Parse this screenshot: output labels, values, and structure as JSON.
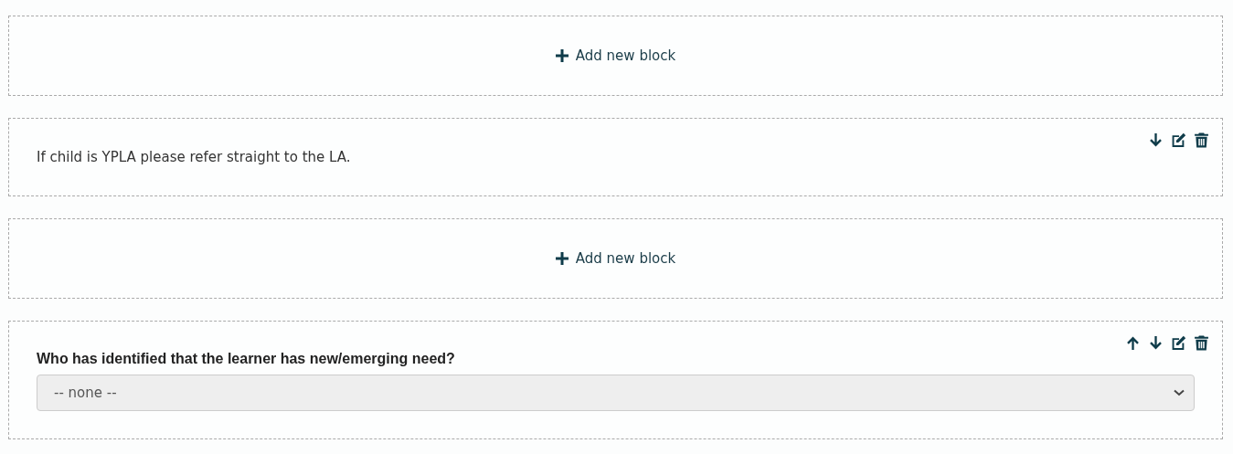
{
  "blocks": [
    {
      "kind": "add",
      "label": "Add new block"
    },
    {
      "kind": "text",
      "text": "If child is YPLA please refer straight to the LA.",
      "actions": [
        {
          "kind": "down"
        },
        {
          "kind": "edit"
        },
        {
          "kind": "delete"
        }
      ]
    },
    {
      "kind": "add",
      "label": "Add new block"
    },
    {
      "kind": "question",
      "label": "Who has identified that the learner has new/emerging need?",
      "select": {
        "value": "-- none --"
      },
      "actions": [
        {
          "kind": "up"
        },
        {
          "kind": "down"
        },
        {
          "kind": "edit"
        },
        {
          "kind": "delete"
        }
      ]
    }
  ]
}
